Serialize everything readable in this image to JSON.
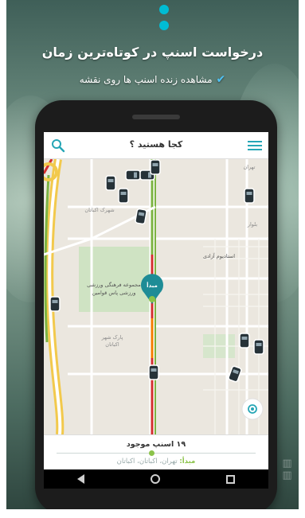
{
  "promo": {
    "headline": "درخواست اسنپ در کوتاه‌ترین زمان",
    "subheadline": "مشاهده زنده اسنپ ها روی نقشه"
  },
  "app": {
    "title": "کجا هستید ؟",
    "search_icon": "search-icon",
    "menu_icon": "hamburger-menu-icon"
  },
  "map": {
    "pin_label": "مبدأ",
    "labels": {
      "area_1": "شهرک اکباتان",
      "stadium": "استادیوم آزادی",
      "cultural_complex": "مجموعه فرهنگی ورزشی",
      "sport_complex": "ورزشی پاس قوامین",
      "park": "پارک شهر",
      "park_sub": "اکباتان",
      "top_right": "تهران",
      "right_mid": "بلوار"
    },
    "locate_icon": "my-location-icon"
  },
  "bottom": {
    "count_text": "۱۹ اسنپ موجود",
    "origin_label": "مبدأ:",
    "origin_address": "تهران، اکباتان، اکباتان"
  },
  "nav": {
    "back_icon": "back-icon",
    "home_icon": "home-icon",
    "recent_icon": "recent-apps-icon"
  },
  "colors": {
    "accent": "#00bcd4",
    "pin": "#1e8c96",
    "route_red": "#d32f2f",
    "route_green": "#7cb342",
    "route_orange": "#f57c00"
  }
}
